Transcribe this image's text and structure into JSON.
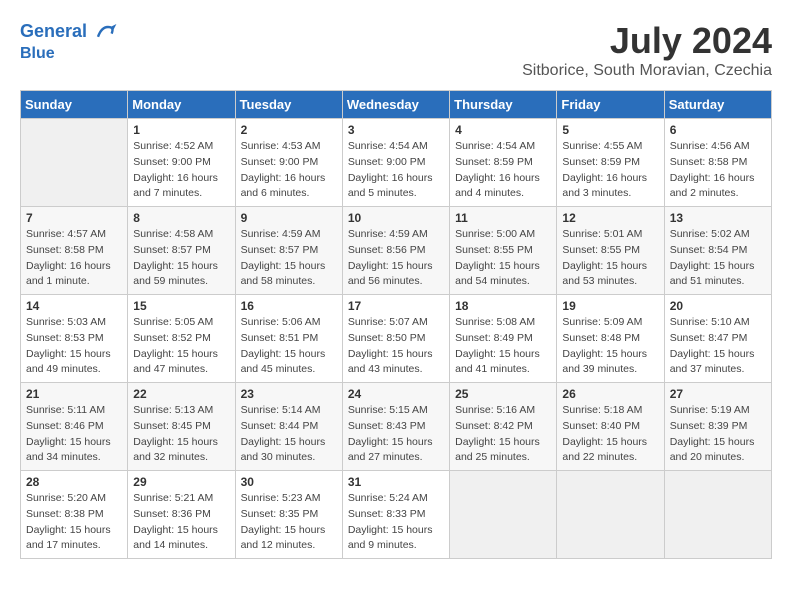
{
  "header": {
    "logo_line1": "General",
    "logo_line2": "Blue",
    "month": "July 2024",
    "location": "Sitborice, South Moravian, Czechia"
  },
  "days_of_week": [
    "Sunday",
    "Monday",
    "Tuesday",
    "Wednesday",
    "Thursday",
    "Friday",
    "Saturday"
  ],
  "weeks": [
    [
      {
        "day": "",
        "sunrise": "",
        "sunset": "",
        "daylight": ""
      },
      {
        "day": "1",
        "sunrise": "Sunrise: 4:52 AM",
        "sunset": "Sunset: 9:00 PM",
        "daylight": "Daylight: 16 hours and 7 minutes."
      },
      {
        "day": "2",
        "sunrise": "Sunrise: 4:53 AM",
        "sunset": "Sunset: 9:00 PM",
        "daylight": "Daylight: 16 hours and 6 minutes."
      },
      {
        "day": "3",
        "sunrise": "Sunrise: 4:54 AM",
        "sunset": "Sunset: 9:00 PM",
        "daylight": "Daylight: 16 hours and 5 minutes."
      },
      {
        "day": "4",
        "sunrise": "Sunrise: 4:54 AM",
        "sunset": "Sunset: 8:59 PM",
        "daylight": "Daylight: 16 hours and 4 minutes."
      },
      {
        "day": "5",
        "sunrise": "Sunrise: 4:55 AM",
        "sunset": "Sunset: 8:59 PM",
        "daylight": "Daylight: 16 hours and 3 minutes."
      },
      {
        "day": "6",
        "sunrise": "Sunrise: 4:56 AM",
        "sunset": "Sunset: 8:58 PM",
        "daylight": "Daylight: 16 hours and 2 minutes."
      }
    ],
    [
      {
        "day": "7",
        "sunrise": "Sunrise: 4:57 AM",
        "sunset": "Sunset: 8:58 PM",
        "daylight": "Daylight: 16 hours and 1 minute."
      },
      {
        "day": "8",
        "sunrise": "Sunrise: 4:58 AM",
        "sunset": "Sunset: 8:57 PM",
        "daylight": "Daylight: 15 hours and 59 minutes."
      },
      {
        "day": "9",
        "sunrise": "Sunrise: 4:59 AM",
        "sunset": "Sunset: 8:57 PM",
        "daylight": "Daylight: 15 hours and 58 minutes."
      },
      {
        "day": "10",
        "sunrise": "Sunrise: 4:59 AM",
        "sunset": "Sunset: 8:56 PM",
        "daylight": "Daylight: 15 hours and 56 minutes."
      },
      {
        "day": "11",
        "sunrise": "Sunrise: 5:00 AM",
        "sunset": "Sunset: 8:55 PM",
        "daylight": "Daylight: 15 hours and 54 minutes."
      },
      {
        "day": "12",
        "sunrise": "Sunrise: 5:01 AM",
        "sunset": "Sunset: 8:55 PM",
        "daylight": "Daylight: 15 hours and 53 minutes."
      },
      {
        "day": "13",
        "sunrise": "Sunrise: 5:02 AM",
        "sunset": "Sunset: 8:54 PM",
        "daylight": "Daylight: 15 hours and 51 minutes."
      }
    ],
    [
      {
        "day": "14",
        "sunrise": "Sunrise: 5:03 AM",
        "sunset": "Sunset: 8:53 PM",
        "daylight": "Daylight: 15 hours and 49 minutes."
      },
      {
        "day": "15",
        "sunrise": "Sunrise: 5:05 AM",
        "sunset": "Sunset: 8:52 PM",
        "daylight": "Daylight: 15 hours and 47 minutes."
      },
      {
        "day": "16",
        "sunrise": "Sunrise: 5:06 AM",
        "sunset": "Sunset: 8:51 PM",
        "daylight": "Daylight: 15 hours and 45 minutes."
      },
      {
        "day": "17",
        "sunrise": "Sunrise: 5:07 AM",
        "sunset": "Sunset: 8:50 PM",
        "daylight": "Daylight: 15 hours and 43 minutes."
      },
      {
        "day": "18",
        "sunrise": "Sunrise: 5:08 AM",
        "sunset": "Sunset: 8:49 PM",
        "daylight": "Daylight: 15 hours and 41 minutes."
      },
      {
        "day": "19",
        "sunrise": "Sunrise: 5:09 AM",
        "sunset": "Sunset: 8:48 PM",
        "daylight": "Daylight: 15 hours and 39 minutes."
      },
      {
        "day": "20",
        "sunrise": "Sunrise: 5:10 AM",
        "sunset": "Sunset: 8:47 PM",
        "daylight": "Daylight: 15 hours and 37 minutes."
      }
    ],
    [
      {
        "day": "21",
        "sunrise": "Sunrise: 5:11 AM",
        "sunset": "Sunset: 8:46 PM",
        "daylight": "Daylight: 15 hours and 34 minutes."
      },
      {
        "day": "22",
        "sunrise": "Sunrise: 5:13 AM",
        "sunset": "Sunset: 8:45 PM",
        "daylight": "Daylight: 15 hours and 32 minutes."
      },
      {
        "day": "23",
        "sunrise": "Sunrise: 5:14 AM",
        "sunset": "Sunset: 8:44 PM",
        "daylight": "Daylight: 15 hours and 30 minutes."
      },
      {
        "day": "24",
        "sunrise": "Sunrise: 5:15 AM",
        "sunset": "Sunset: 8:43 PM",
        "daylight": "Daylight: 15 hours and 27 minutes."
      },
      {
        "day": "25",
        "sunrise": "Sunrise: 5:16 AM",
        "sunset": "Sunset: 8:42 PM",
        "daylight": "Daylight: 15 hours and 25 minutes."
      },
      {
        "day": "26",
        "sunrise": "Sunrise: 5:18 AM",
        "sunset": "Sunset: 8:40 PM",
        "daylight": "Daylight: 15 hours and 22 minutes."
      },
      {
        "day": "27",
        "sunrise": "Sunrise: 5:19 AM",
        "sunset": "Sunset: 8:39 PM",
        "daylight": "Daylight: 15 hours and 20 minutes."
      }
    ],
    [
      {
        "day": "28",
        "sunrise": "Sunrise: 5:20 AM",
        "sunset": "Sunset: 8:38 PM",
        "daylight": "Daylight: 15 hours and 17 minutes."
      },
      {
        "day": "29",
        "sunrise": "Sunrise: 5:21 AM",
        "sunset": "Sunset: 8:36 PM",
        "daylight": "Daylight: 15 hours and 14 minutes."
      },
      {
        "day": "30",
        "sunrise": "Sunrise: 5:23 AM",
        "sunset": "Sunset: 8:35 PM",
        "daylight": "Daylight: 15 hours and 12 minutes."
      },
      {
        "day": "31",
        "sunrise": "Sunrise: 5:24 AM",
        "sunset": "Sunset: 8:33 PM",
        "daylight": "Daylight: 15 hours and 9 minutes."
      },
      {
        "day": "",
        "sunrise": "",
        "sunset": "",
        "daylight": ""
      },
      {
        "day": "",
        "sunrise": "",
        "sunset": "",
        "daylight": ""
      },
      {
        "day": "",
        "sunrise": "",
        "sunset": "",
        "daylight": ""
      }
    ]
  ]
}
